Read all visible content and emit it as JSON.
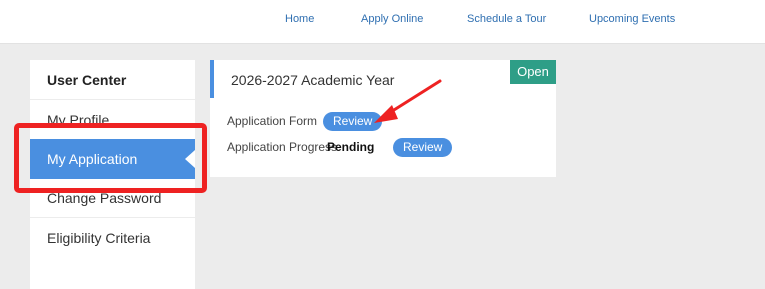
{
  "nav": {
    "links": [
      "Home",
      "Apply Online",
      "Schedule a Tour",
      "Upcoming Events"
    ],
    "link_color": "#2f6fb1"
  },
  "sidebar": {
    "title": "User Center",
    "items": [
      {
        "label": "My Profile",
        "active": false
      },
      {
        "label": "My Application",
        "active": true
      },
      {
        "label": "Change Password",
        "active": false
      },
      {
        "label": "Eligibility Criteria",
        "active": false
      }
    ],
    "active_color": "#4a8fe0"
  },
  "application": {
    "year": "2026-2027 Academic Year",
    "status_badge": "Open",
    "status_color": "#2e9e87",
    "form_label": "Application Form",
    "form_button": "Review",
    "progress_label": "Application Progress",
    "progress_value": "Pending",
    "progress_button": "Review",
    "button_color": "#4a8fe0"
  },
  "annotations": {
    "highlight_color": "#ee2222"
  }
}
